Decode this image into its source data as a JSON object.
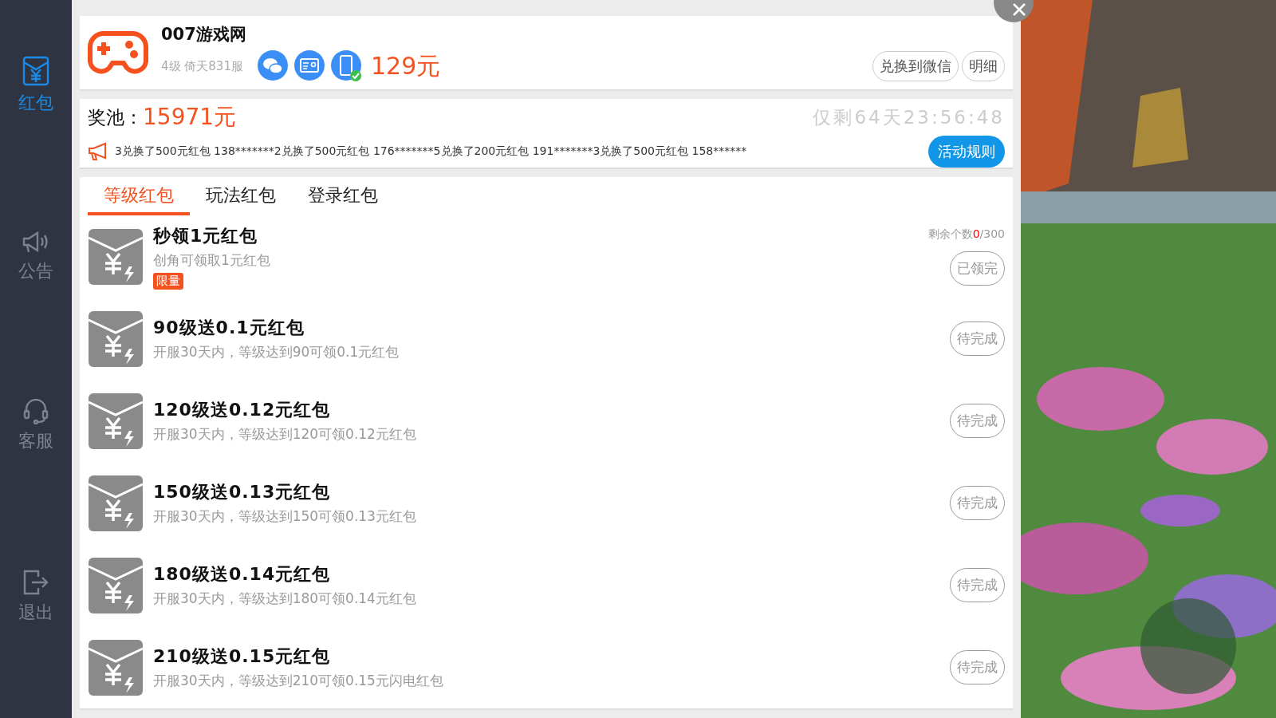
{
  "sidebar": {
    "items": [
      {
        "kind": "redpacket",
        "label": "红包",
        "selected": true
      },
      {
        "kind": "notice",
        "label": "公告",
        "selected": false
      },
      {
        "kind": "service",
        "label": "客服",
        "selected": false
      },
      {
        "kind": "logout",
        "label": "退出",
        "selected": false
      }
    ]
  },
  "account": {
    "name": "007游戏网",
    "info": "4级 倚天831服",
    "balance": "129元",
    "bindings": [
      {
        "kind": "wechat",
        "verified": false
      },
      {
        "kind": "idcard",
        "verified": false
      },
      {
        "kind": "phone",
        "verified": true
      }
    ],
    "buttons": [
      "兑换到微信",
      "明细"
    ]
  },
  "pool": {
    "label": "奖池：",
    "amount": "15971元",
    "countdown": "仅剩64天23:56:48",
    "ticker": "3兑换了500元红包 138*******2兑换了500元红包 176*******5兑换了200元红包 191*******3兑换了500元红包 158******",
    "rules_button": "活动规则"
  },
  "tabs": [
    {
      "label": "等级红包",
      "selected": true
    },
    {
      "label": "玩法红包",
      "selected": false
    },
    {
      "label": "登录红包",
      "selected": false
    }
  ],
  "rewards": [
    {
      "title": "秒领1元红包",
      "desc": "创角可领取1元红包",
      "tag": "限量",
      "remaining_label": "剩余个数",
      "remaining_count": "0",
      "remaining_total": "/300",
      "status": "已领完"
    },
    {
      "title": "90级送0.1元红包",
      "desc": "开服30天内，等级达到90可领0.1元红包",
      "status": "待完成"
    },
    {
      "title": "120级送0.12元红包",
      "desc": "开服30天内，等级达到120可领0.12元红包",
      "status": "待完成"
    },
    {
      "title": "150级送0.13元红包",
      "desc": "开服30天内，等级达到150可领0.13元红包",
      "status": "待完成"
    },
    {
      "title": "180级送0.14元红包",
      "desc": "开服30天内，等级达到180可领0.14元红包",
      "status": "待完成"
    },
    {
      "title": "210级送0.15元红包",
      "desc": "开服30天内，等级达到210可领0.15元闪电红包",
      "status": "待完成"
    }
  ]
}
